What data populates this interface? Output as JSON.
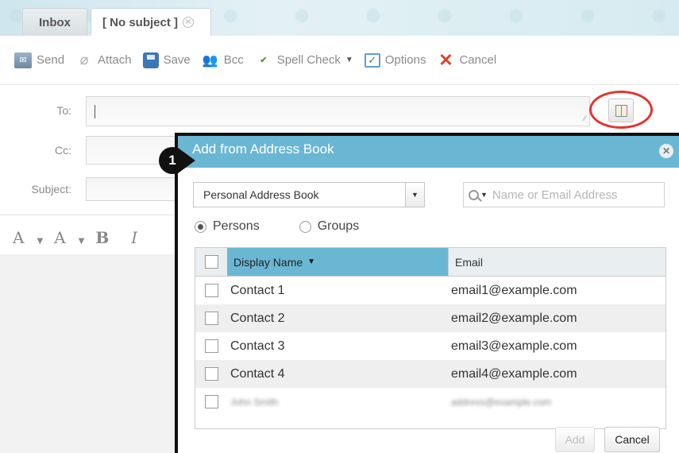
{
  "tabs": [
    {
      "label": "Inbox"
    },
    {
      "label": "[ No subject ]"
    }
  ],
  "toolbar": {
    "send": "Send",
    "attach": "Attach",
    "save": "Save",
    "bcc": "Bcc",
    "spell_check": "Spell Check",
    "options": "Options",
    "cancel": "Cancel"
  },
  "form": {
    "to_label": "To:",
    "cc_label": "Cc:",
    "subject_label": "Subject:"
  },
  "format_bar": {
    "font_icon": "A",
    "highlight_icon": "A",
    "bold": "B",
    "italic": "I"
  },
  "step": "1",
  "dialog": {
    "title": "Add from Address Book",
    "address_book_select": "Personal Address Book",
    "search_placeholder": "Name or Email Address",
    "radio_persons": "Persons",
    "radio_groups": "Groups",
    "columns": {
      "name": "Display Name",
      "email": "Email"
    },
    "rows": [
      {
        "name": "Contact 1",
        "email": "email1@example.com"
      },
      {
        "name": "Contact 2",
        "email": "email2@example.com"
      },
      {
        "name": "Contact 3",
        "email": "email3@example.com"
      },
      {
        "name": "Contact 4",
        "email": "email4@example.com"
      },
      {
        "name": "John Smith",
        "email": "address@example.com"
      }
    ],
    "add": "Add",
    "cancel": "Cancel"
  },
  "colors": {
    "accent": "#6ab7d4",
    "highlight_circle": "#e3342f"
  }
}
